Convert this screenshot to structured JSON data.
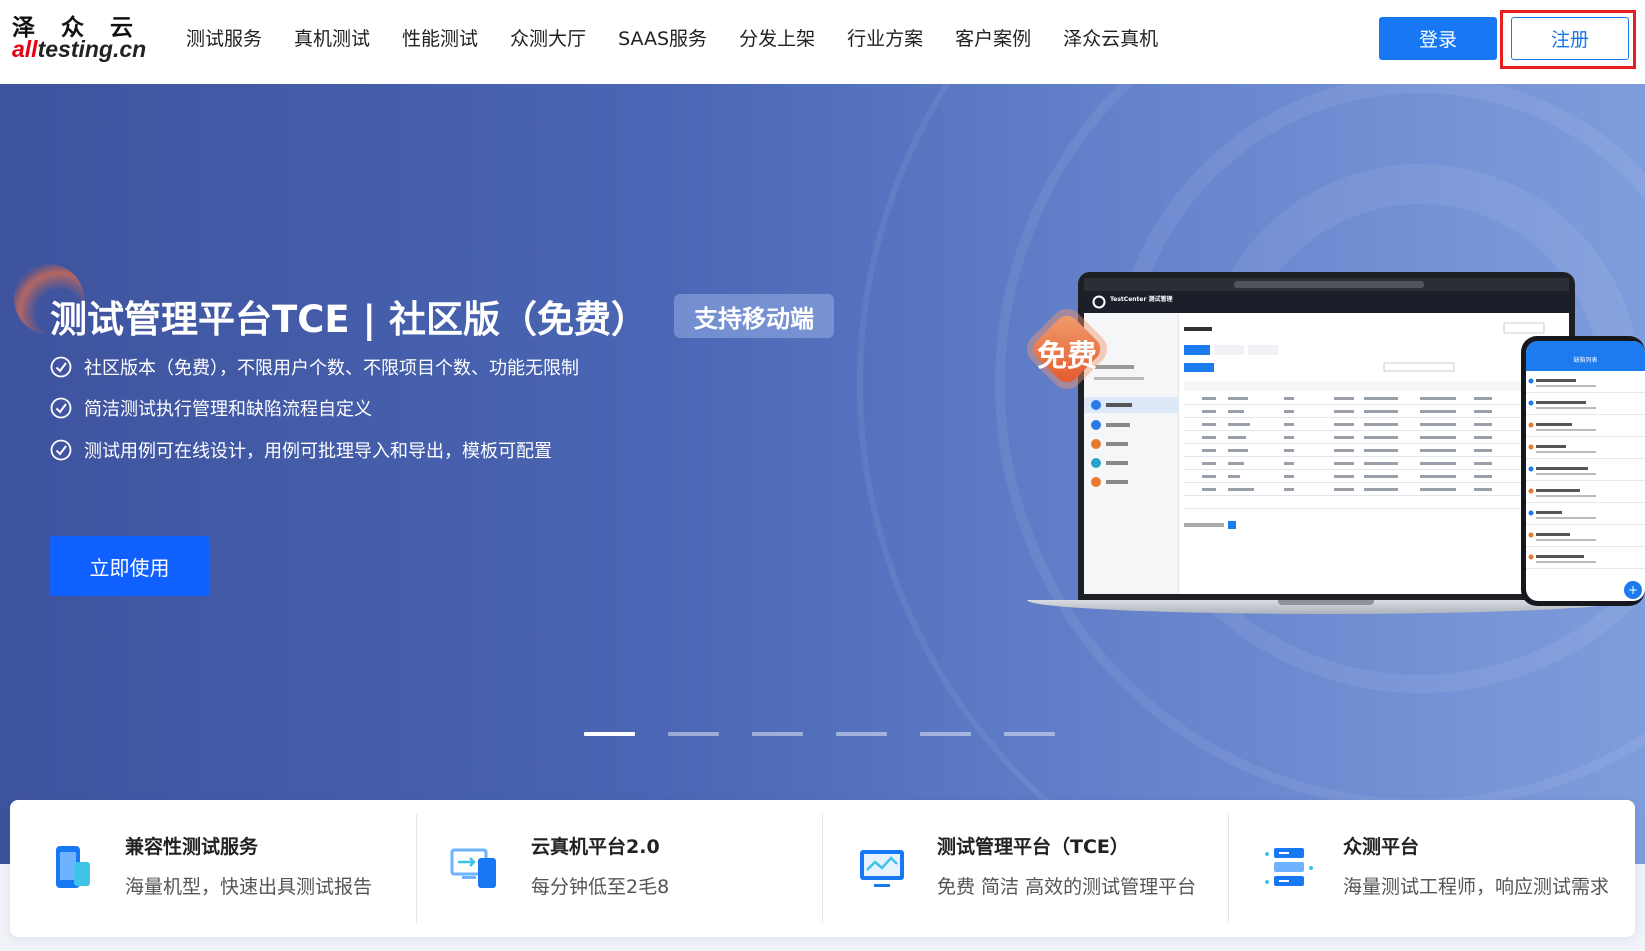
{
  "brand": {
    "logo_cn": "泽众云",
    "logo_en_hl": "all",
    "logo_en_rest": "testing.cn"
  },
  "nav": [
    {
      "label": "测试服务"
    },
    {
      "label": "真机测试"
    },
    {
      "label": "性能测试"
    },
    {
      "label": "众测大厅"
    },
    {
      "label": "SAAS服务"
    },
    {
      "label": "分发上架"
    },
    {
      "label": "行业方案"
    },
    {
      "label": "客户案例"
    },
    {
      "label": "泽众云真机"
    }
  ],
  "auth": {
    "login": "登录",
    "register": "注册"
  },
  "hero": {
    "title": "测试管理平台TCE | 社区版（免费）",
    "badge": "支持移动端",
    "features": [
      "社区版本（免费），不限用户个数、不限项目个数、功能无限制",
      "简洁测试执行管理和缺陷流程自定义",
      "测试用例可在线设计，用例可批理导入和导出，模板可配置"
    ],
    "cta": "立即使用",
    "free_badge": "免费",
    "slides": 6,
    "active_slide": 1
  },
  "mockup": {
    "app_name": "TestCenter 测试管理",
    "mobile_title": "缺陷列表"
  },
  "services": [
    {
      "title": "兼容性测试服务",
      "desc": "海量机型，快速出具测试报告",
      "icon": "phone-icon"
    },
    {
      "title": "云真机平台2.0",
      "desc": "每分钟低至2毛8",
      "icon": "cloud-device-icon"
    },
    {
      "title": "测试管理平台（TCE）",
      "desc": "免费 简洁 高效的测试管理平台",
      "icon": "monitor-chart-icon"
    },
    {
      "title": "众测平台",
      "desc": "海量测试工程师，响应测试需求",
      "icon": "server-stack-icon"
    }
  ],
  "colors": {
    "primary": "#1877f2",
    "cta": "#1060ff",
    "highlight": "#e62020",
    "brand_red": "#e60012"
  }
}
